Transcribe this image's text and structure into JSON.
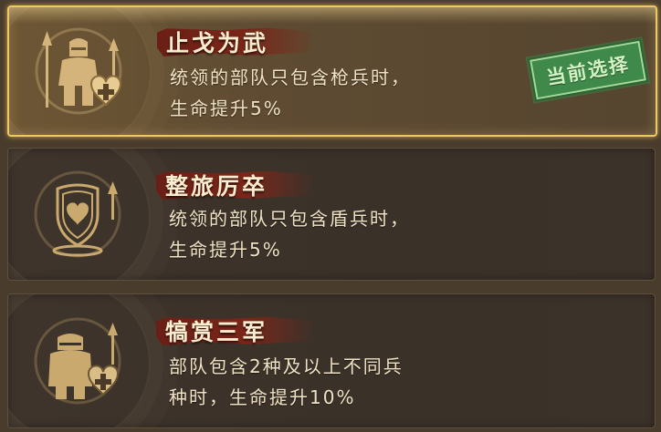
{
  "options": [
    {
      "title": "止戈为武",
      "desc": "统领的部队只包含枪兵时，\n生命提升5%",
      "icon": "spearman-heal-icon",
      "selected": true,
      "badge": "当前选择"
    },
    {
      "title": "整旅厉卒",
      "desc": "统领的部队只包含盾兵时，\n生命提升5%",
      "icon": "shield-heart-icon",
      "selected": false
    },
    {
      "title": "犒赏三军",
      "desc": "部队包含2种及以上不同兵\n种时，生命提升10%",
      "icon": "mixed-troops-heal-icon",
      "selected": false
    }
  ],
  "colors": {
    "selected_border": "#f0c860",
    "title_brush": "#7a2619",
    "stamp_green": "#3f8a4a",
    "icon_gold": "#c9a96e"
  }
}
